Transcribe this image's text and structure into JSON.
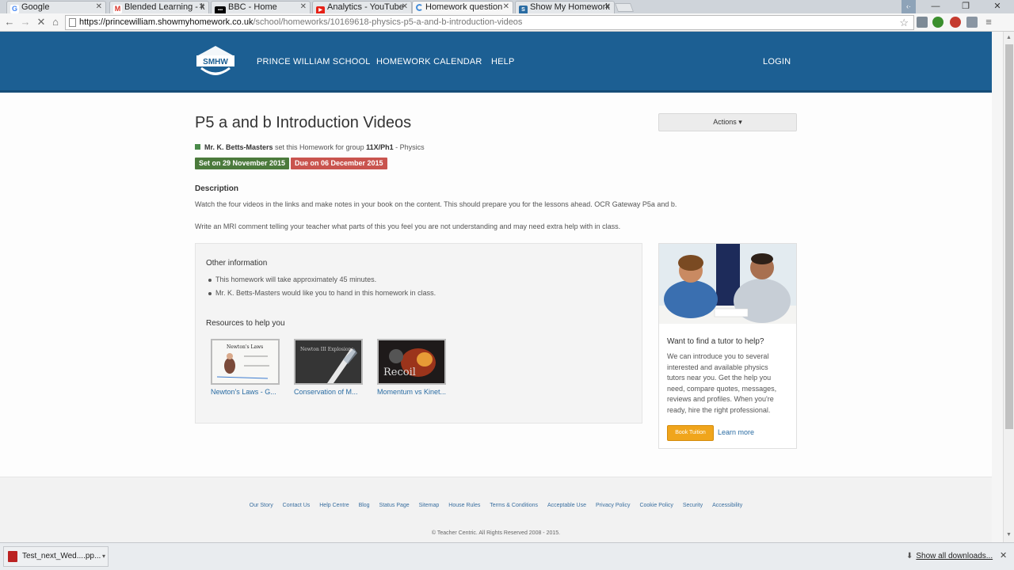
{
  "browser": {
    "tabs": [
      {
        "title": "Google",
        "icon": "google-favicon"
      },
      {
        "title": "Blended Learning - k",
        "icon": "gmail-favicon"
      },
      {
        "title": "BBC - Home",
        "icon": "bbc-favicon"
      },
      {
        "title": "Analytics - YouTube",
        "icon": "youtube-favicon"
      },
      {
        "title": "Homework question",
        "icon": "loading-spinner"
      },
      {
        "title": "Show My Homework",
        "icon": "smhw-favicon"
      }
    ],
    "url_host": "https://princewilliam.showmyhomework.co.uk",
    "url_path": "/school/homeworks/10169618-physics-p5-a-and-b-introduction-videos"
  },
  "header": {
    "logo_text": "SMHW",
    "nav": [
      "PRINCE WILLIAM SCHOOL",
      "HOMEWORK CALENDAR",
      "HELP"
    ],
    "login": "LOGIN",
    "bg_color": "#1c5f93"
  },
  "homework": {
    "title": "P5 a and b Introduction Videos",
    "actions_label": "Actions ▾",
    "teacher": "Mr. K. Betts-Masters",
    "set_text": " set this Homework for group ",
    "group": "11X/Ph1",
    "subject": " - Physics",
    "set_badge": "Set on 29 November 2015",
    "due_badge": "Due on 06 December 2015",
    "description_heading": "Description",
    "description": [
      "Watch the four videos in the links and make notes in your book on the content.  This should prepare you for the lessons ahead.  OCR Gateway P5a and b.",
      "Write an MRI comment telling your teacher what parts of this you feel you are not understanding and may need extra help with in class."
    ]
  },
  "other_info": {
    "heading": "Other information",
    "items": [
      "This homework will take approximately 45 minutes.",
      "Mr. K. Betts-Masters would like you to hand in this homework in class."
    ]
  },
  "resources": {
    "heading": "Resources to help you",
    "items": [
      {
        "label": "Newton's Laws - G...",
        "thumb_text": "Newton's Laws"
      },
      {
        "label": "Conservation of M...",
        "thumb_text": "Newton III Explosions"
      },
      {
        "label": "Momentum vs Kinet...",
        "thumb_text": "Recoil"
      }
    ]
  },
  "tutor": {
    "heading": "Want to find a tutor to help?",
    "body": "We can introduce you to several interested and available physics tutors near you. Get the help you need, compare quotes, messages, reviews and profiles. When you're ready, hire the right professional.",
    "book_button": "Book Tuition",
    "learn_more": "Learn more"
  },
  "footer": {
    "links": [
      "Our Story",
      "Contact Us",
      "Help Centre",
      "Blog",
      "Status Page",
      "Sitemap",
      "House Rules",
      "Terms & Conditions",
      "Acceptable Use",
      "Privacy Policy",
      "Cookie Policy",
      "Security",
      "Accessibility"
    ],
    "copyright": "© Teacher Centric. All Rights Reserved 2008 - 2015."
  },
  "downloads": {
    "file": "Test_next_Wed....pp...",
    "show_all": "Show all downloads..."
  }
}
